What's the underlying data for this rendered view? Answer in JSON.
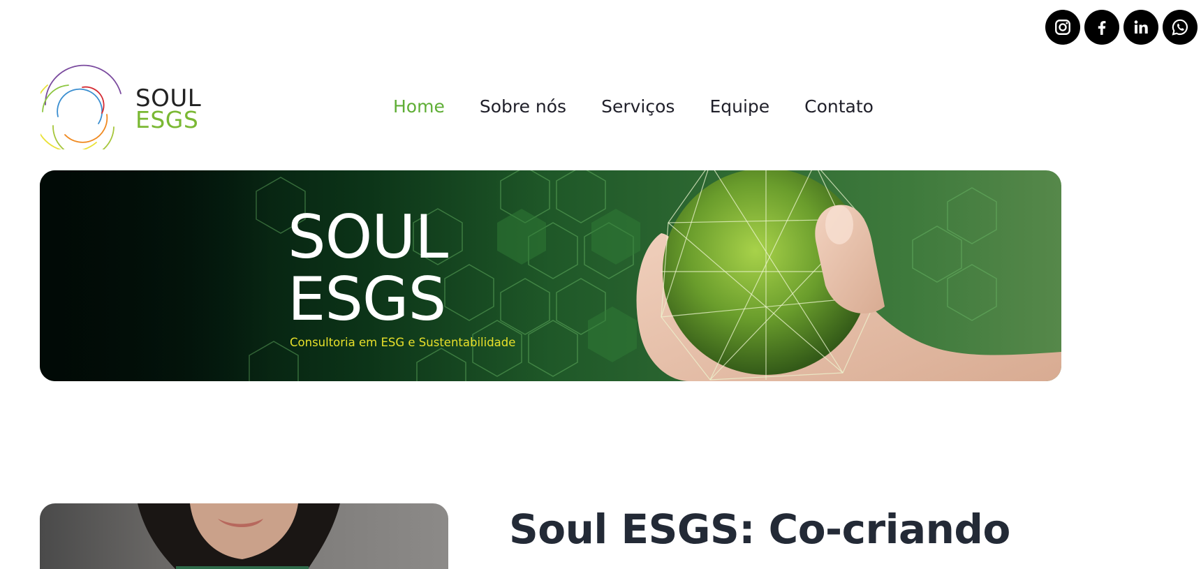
{
  "social": [
    {
      "name": "instagram-icon"
    },
    {
      "name": "facebook-icon"
    },
    {
      "name": "linkedin-icon"
    },
    {
      "name": "whatsapp-icon"
    }
  ],
  "logo": {
    "line1": "SOUL",
    "line2": "ESGS"
  },
  "nav": {
    "items": [
      {
        "label": "Home",
        "active": true
      },
      {
        "label": "Sobre nós"
      },
      {
        "label": "Serviços"
      },
      {
        "label": "Equipe"
      },
      {
        "label": "Contato"
      }
    ]
  },
  "banner": {
    "title_line1": "SOUL",
    "title_line2": "ESGS",
    "tagline": "Consultoria em ESG e Sustentabilidade"
  },
  "main": {
    "heading": "Soul ESGS: Co-criando"
  },
  "colors": {
    "nav_active": "#5fae36",
    "nav_text": "#1f1f29",
    "tagline": "#e8e02a",
    "heading": "#232a36"
  }
}
